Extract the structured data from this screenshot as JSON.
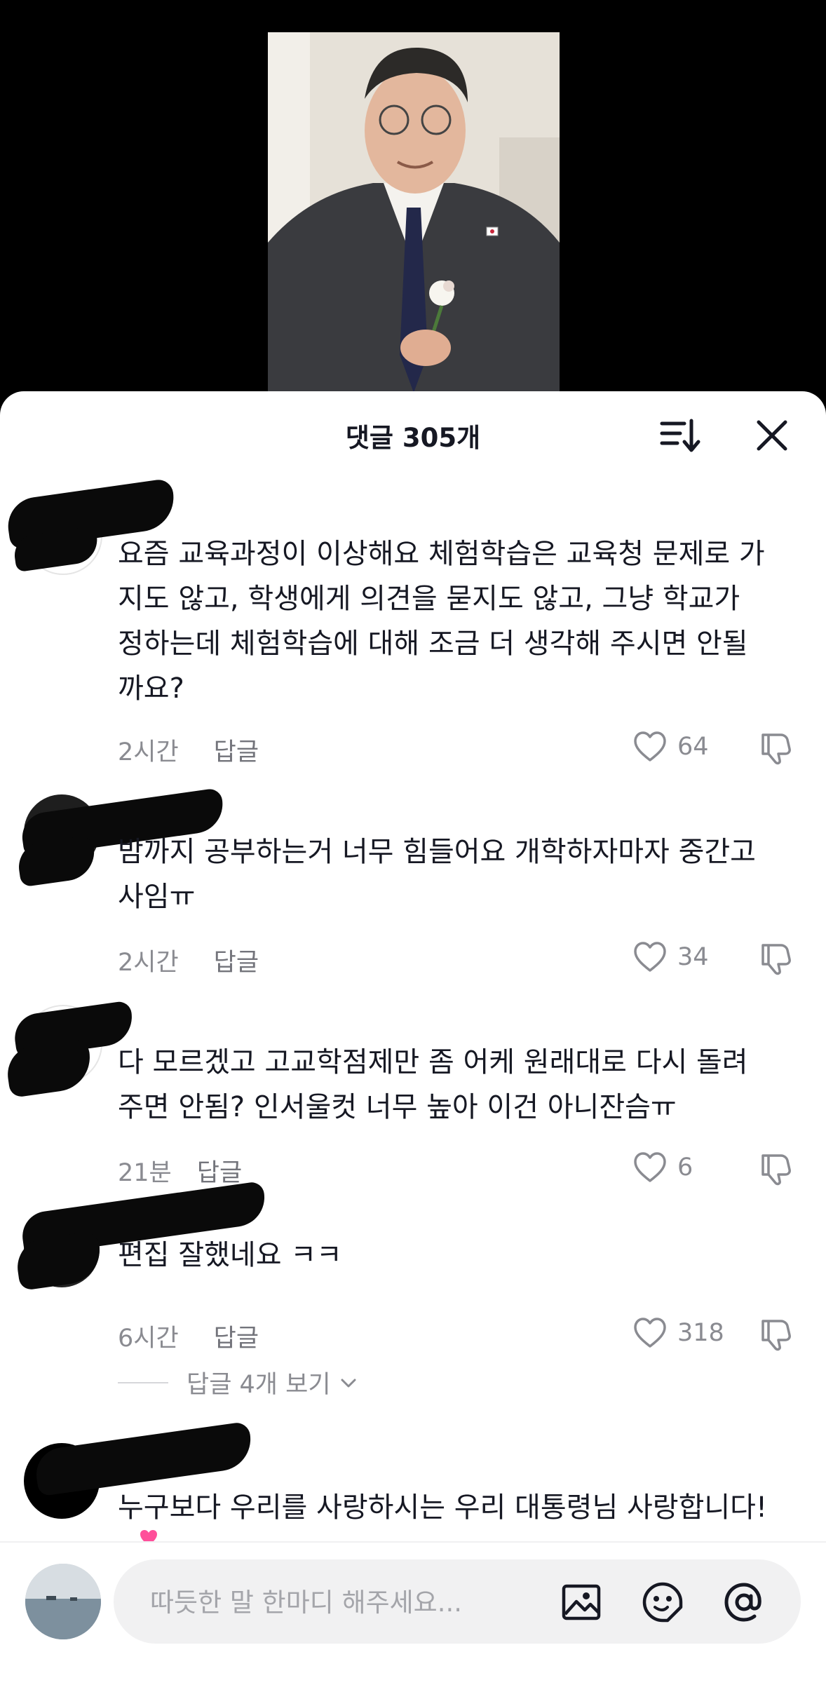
{
  "header": {
    "title": "댓글 305개"
  },
  "comments": [
    {
      "text": "요즘 교육과정이 이상해요 체험학습은 교육청 문제로 가\n지도 않고, 학생에게 의견을 묻지도 않고, 그냥 학교가\n정하는데 체험학습에 대해 조금 더 생각해 주시면 안될\n까요?",
      "time": "2시간",
      "reply": "답글",
      "likes": "64"
    },
    {
      "text": "밤까지 공부하는거 너무 힘들어요 개학하자마자 중간고\n사임ㅠ",
      "time": "2시간",
      "reply": "답글",
      "likes": "34"
    },
    {
      "text": "다 모르겠고 고교학점제만 좀 어케 원래대로 다시 돌려\n주면 안됨? 인서울컷 너무 높아 이건 아니잔슴ㅠ",
      "time": "21분",
      "reply": "답글",
      "likes": "6"
    },
    {
      "text": "편집 잘했네요 ㅋㅋ",
      "time": "6시간",
      "reply": "답글",
      "likes": "318"
    },
    {
      "text": "누구보다 우리를 사랑하시는 우리 대통령님 사랑합니다!"
    }
  ],
  "view_replies": "답글 4개 보기",
  "input": {
    "placeholder": "따듯한 말 한마디 해주세요..."
  },
  "colors": {
    "accent_emoji": "#ff4f9a",
    "meta_text": "#8a8b91"
  },
  "icons": [
    "sort-icon",
    "close-icon",
    "heart-icon",
    "dislike-icon",
    "image-icon",
    "emoji-icon",
    "mention-icon",
    "heart-emoji-icon"
  ]
}
